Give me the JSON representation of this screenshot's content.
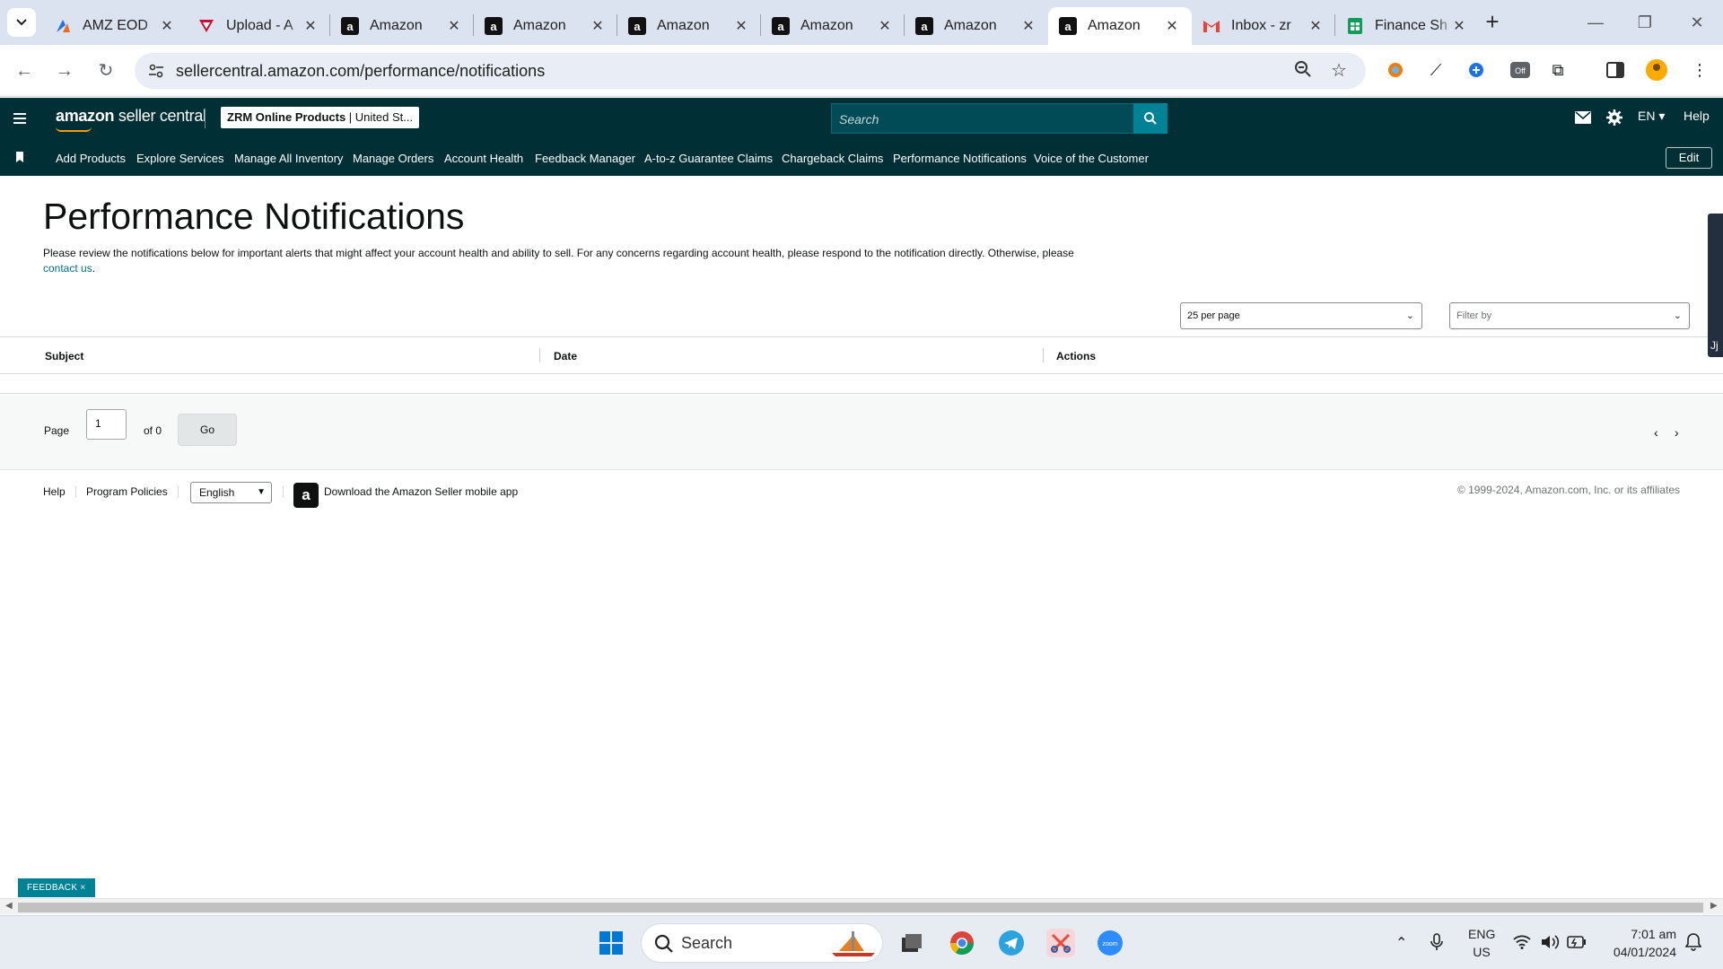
{
  "browser": {
    "tabs": [
      {
        "title": "AMZ EOD",
        "favicon": "amz-eod-icon",
        "active": false
      },
      {
        "title": "Upload - A",
        "favicon": "upload-icon",
        "active": false
      },
      {
        "title": "Amazon",
        "favicon": "amazon-icon",
        "active": false
      },
      {
        "title": "Amazon",
        "favicon": "amazon-icon",
        "active": false
      },
      {
        "title": "Amazon",
        "favicon": "amazon-icon",
        "active": false
      },
      {
        "title": "Amazon",
        "favicon": "amazon-icon",
        "active": false
      },
      {
        "title": "Amazon",
        "favicon": "amazon-icon",
        "active": false
      },
      {
        "title": "Amazon",
        "favicon": "amazon-icon",
        "active": true
      },
      {
        "title": "Inbox - zr",
        "favicon": "gmail-icon",
        "active": false
      },
      {
        "title": "Finance Sh",
        "favicon": "sheets-icon",
        "active": false
      }
    ],
    "url": "sellercentral.amazon.com/performance/notifications"
  },
  "header": {
    "logo_brand": "amazon",
    "logo_suffix": " seller central",
    "account_bold": "ZRM Online Products",
    "account_region": " | United St...",
    "search_placeholder": "Search",
    "language": "EN",
    "help": "Help"
  },
  "nav": {
    "items": [
      "Add Products",
      "Explore Services",
      "Manage All Inventory",
      "Manage Orders",
      "Account Health",
      "Feedback Manager",
      "A-to-z Guarantee Claims",
      "Chargeback Claims",
      "Performance Notifications",
      "Voice of the Customer"
    ],
    "edit": "Edit"
  },
  "main": {
    "title": "Performance Notifications",
    "description": "Please review the notifications below for important alerts that might affect your account health and ability to sell. For any concerns regarding account health, please respond to the notification directly. Otherwise, please",
    "contact_link": "contact us",
    "per_page": "25 per page",
    "filter_placeholder": "Filter by",
    "columns": [
      "Subject",
      "Date",
      "Actions"
    ],
    "pagination": {
      "page_label": "Page",
      "page_value": "1",
      "of_label": "of 0",
      "go": "Go"
    }
  },
  "footer": {
    "help": "Help",
    "program_policies": "Program Policies",
    "language": "English",
    "download_app": "Download the Amazon Seller mobile app",
    "copyright": "© 1999-2024, Amazon.com, Inc. or its affiliates"
  },
  "side_tab_label": "Jj",
  "feedback": "FEEDBACK ×",
  "taskbar": {
    "search": "Search",
    "lang_line1": "ENG",
    "lang_line2": "US",
    "time": "7:01 am",
    "date": "04/01/2024"
  },
  "colors": {
    "header_bg": "#002f36",
    "search_button": "#008296",
    "link": "#007185",
    "feedback_bg": "#008296"
  }
}
